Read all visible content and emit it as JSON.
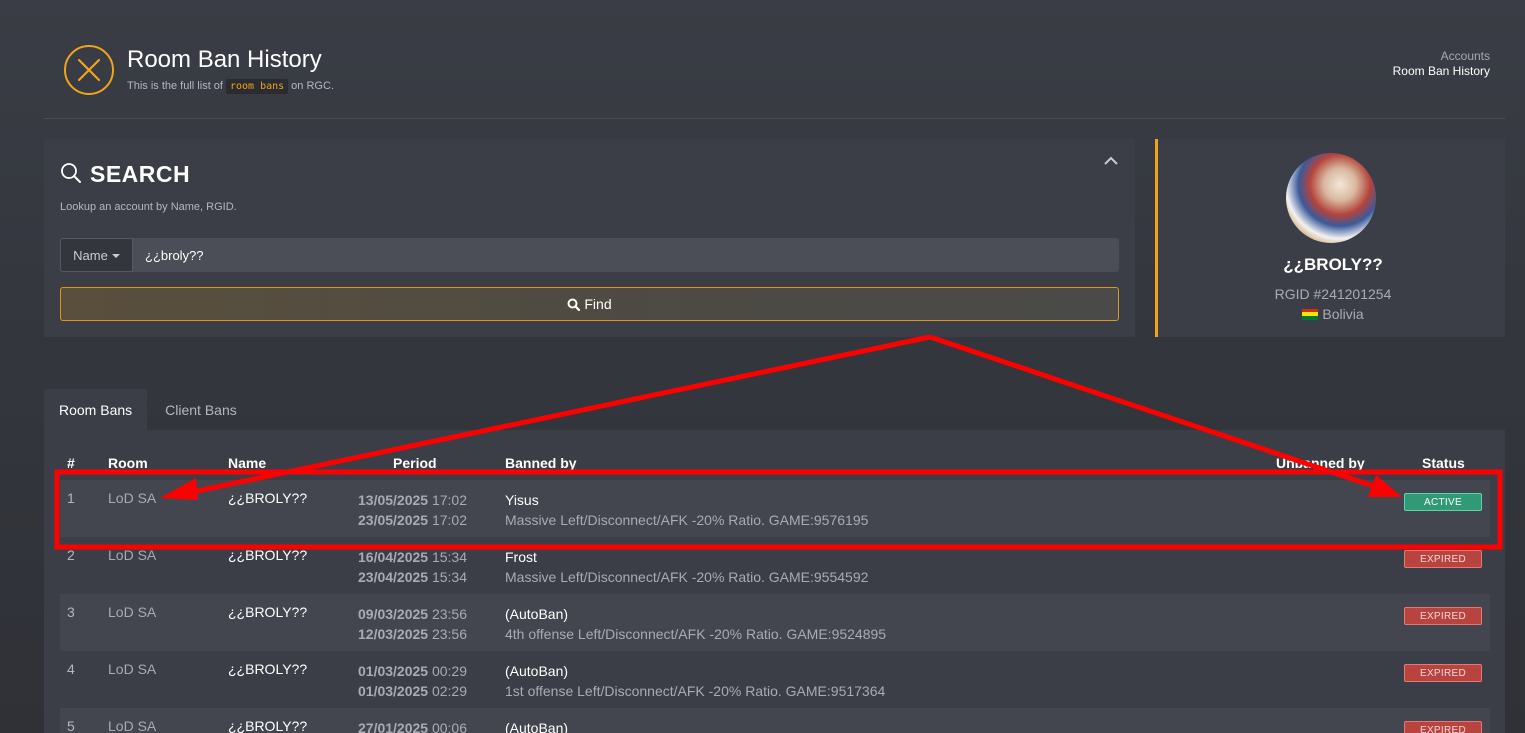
{
  "header": {
    "title": "Room Ban History",
    "subtitle_pre": "This is the full list of",
    "subtitle_code": "room bans",
    "subtitle_post": "on RGC.",
    "accent_color": "#f0a41c"
  },
  "breadcrumb": {
    "parent": "Accounts",
    "current": "Room Ban History"
  },
  "search": {
    "title": "SEARCH",
    "hint": "Lookup an account by Name, RGID.",
    "field_type": "Name",
    "value": "¿¿broly??",
    "button_label": "Find"
  },
  "profile": {
    "name": "¿¿BROLY??",
    "rgid": "RGID #241201254",
    "country": "Bolivia"
  },
  "tabs": [
    {
      "label": "Room Bans",
      "active": true
    },
    {
      "label": "Client Bans",
      "active": false
    }
  ],
  "table": {
    "columns": [
      "#",
      "Room",
      "Name",
      "Period",
      "Banned by",
      "Unbanned by",
      "Status"
    ],
    "rows": [
      {
        "num": "1",
        "room": "LoD SA",
        "name": "¿¿BROLY??",
        "start_date": "13/05/2025",
        "start_time": "17:02",
        "end_date": "23/05/2025",
        "end_time": "17:02",
        "banned_by": "Yisus",
        "reason": "Massive Left/Disconnect/AFK -20% Ratio. GAME:9576195",
        "status": "ACTIVE"
      },
      {
        "num": "2",
        "room": "LoD SA",
        "name": "¿¿BROLY??",
        "start_date": "16/04/2025",
        "start_time": "15:34",
        "end_date": "23/04/2025",
        "end_time": "15:34",
        "banned_by": "Frost",
        "reason": "Massive Left/Disconnect/AFK -20% Ratio. GAME:9554592",
        "status": "EXPIRED"
      },
      {
        "num": "3",
        "room": "LoD SA",
        "name": "¿¿BROLY??",
        "start_date": "09/03/2025",
        "start_time": "23:56",
        "end_date": "12/03/2025",
        "end_time": "23:56",
        "banned_by": "(AutoBan)",
        "reason": "4th offense Left/Disconnect/AFK -20% Ratio. GAME:9524895",
        "status": "EXPIRED"
      },
      {
        "num": "4",
        "room": "LoD SA",
        "name": "¿¿BROLY??",
        "start_date": "01/03/2025",
        "start_time": "00:29",
        "end_date": "01/03/2025",
        "end_time": "02:29",
        "banned_by": "(AutoBan)",
        "reason": "1st offense Left/Disconnect/AFK -20% Ratio. GAME:9517364",
        "status": "EXPIRED"
      },
      {
        "num": "5",
        "room": "LoD SA",
        "name": "¿¿BROLY??",
        "start_date": "27/01/2025",
        "start_time": "00:06",
        "end_date": "",
        "end_time": "",
        "banned_by": "(AutoBan)",
        "reason": "",
        "status": "EXPIRED"
      }
    ]
  },
  "annotation_color": "#ff0000"
}
